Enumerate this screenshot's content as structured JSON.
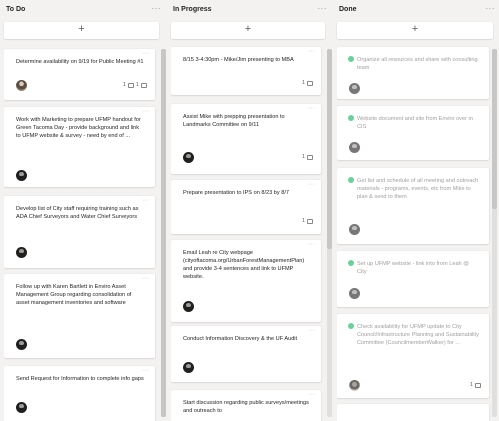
{
  "columns": [
    {
      "title": "To Do",
      "more": "···",
      "add": "+",
      "cards": [
        {
          "title": "Determine availability on 9/19 for Public Meeting #1",
          "avatar": "photo",
          "meta": [
            "1",
            "1"
          ]
        },
        {
          "title": "Work with Marketing to prepare UFMP handout for Green Tacoma Day - provide background and link to UFMP website & survey - need by end of ...",
          "avatar": "dark",
          "meta": []
        },
        {
          "title": "Develop list of City staff requiring training such as ADA Chief Surveyors and Water Chief Surveyors",
          "avatar": "dark",
          "meta": []
        },
        {
          "title": "Follow up with Karen Bartlett in Enviro Asset Management Group regarding consolidation of asset management inventories and software",
          "avatar": "dark",
          "meta": []
        },
        {
          "title": "Send Request for Information to complete info gaps",
          "avatar": "dark",
          "meta": []
        }
      ]
    },
    {
      "title": "In Progress",
      "more": "···",
      "add": "+",
      "cards": [
        {
          "title": "8/15 3-4:30pm - Mike/Jim presenting to MBA",
          "avatar": null,
          "meta": [
            "1"
          ]
        },
        {
          "title": "Assist Mike with prepping presentation to Landmarks Committee on 9/11",
          "avatar": "dark",
          "meta": [
            "1"
          ]
        },
        {
          "title": "Prepare presentation to IPS on 8/23 by 8/7",
          "avatar": null,
          "meta": [
            "1"
          ]
        },
        {
          "title": "Email Leah re City webpage (cityoftacoma.org/UrbanForestManagementPlan) and provide 3-4 sentences and link to UFMP website.",
          "avatar": "dark",
          "meta": []
        },
        {
          "title": "Conduct Information Discovery & the UF Audit",
          "avatar": "dark",
          "meta": []
        },
        {
          "title": "Start discussion regarding public surveys/meetings and outreach to",
          "avatar": null,
          "meta": []
        }
      ]
    },
    {
      "title": "Done",
      "more": "···",
      "add": "+",
      "cards": [
        {
          "title": "Organize all resources and share with consulting team",
          "avatar": "grey",
          "meta": []
        },
        {
          "title": "Website document and site from Enviro over in CIS",
          "avatar": "grey",
          "meta": []
        },
        {
          "title": "Get list and schedule of all meeting and outreach materials - programs, events, etc from Mike to plan & send to them",
          "avatar": "grey",
          "meta": []
        },
        {
          "title": "Set up UFMP website - link into from Leah @ City",
          "avatar": "grey",
          "meta": []
        },
        {
          "title": "Check availability for UFMP update to City Council/Infrastructure Planning and Sustainability Committee (CouncilmemberWalker) for ...",
          "avatar": "photo2",
          "meta": [
            "1"
          ]
        }
      ]
    }
  ],
  "colors": {
    "background": "#f3f2f1",
    "card": "#ffffff",
    "complete": "#6bd19a"
  }
}
